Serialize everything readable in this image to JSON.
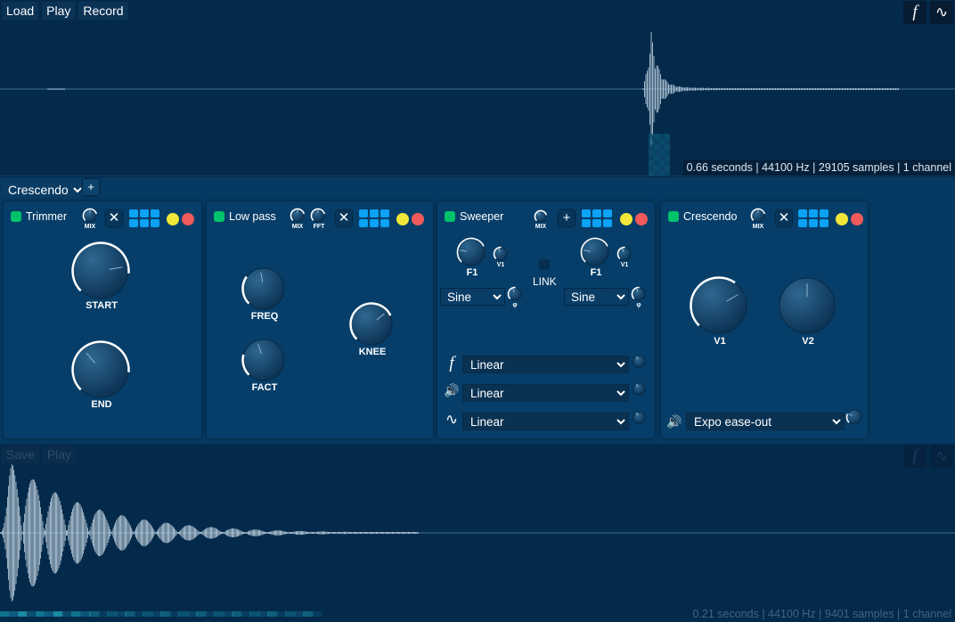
{
  "top_panel": {
    "buttons": [
      "Load",
      "Play",
      "Record"
    ],
    "view_icons": [
      "f",
      "∿"
    ],
    "info": "0.66 seconds | 44100 Hz | 29105 samples | 1 channel"
  },
  "chain": {
    "selected": "Crescendo",
    "add_label": "+"
  },
  "trimmer": {
    "title": "Trimmer",
    "mix_label": "MIX",
    "close_label": "✕",
    "knobs": {
      "start": "START",
      "end": "END"
    }
  },
  "lowpass": {
    "title": "Low pass",
    "mix_label": "MIX",
    "fft_label": "FFT",
    "close_label": "✕",
    "knobs": {
      "freq": "FREQ",
      "fact": "FACT",
      "knee": "KNEE"
    }
  },
  "sweeper": {
    "title": "Sweeper",
    "mix_label": "MIX",
    "add_label": "+",
    "f1_label": "F1",
    "v1_label": "V1",
    "phi_label": "φ",
    "link_label": "LINK",
    "wave_left": "Sine",
    "wave_right": "Sine",
    "curves": [
      {
        "icon": "f",
        "value": "Linear"
      },
      {
        "icon": "🔊",
        "value": "Linear"
      },
      {
        "icon": "∿",
        "value": "Linear"
      }
    ]
  },
  "crescendo": {
    "title": "Crescendo",
    "mix_label": "MIX",
    "close_label": "✕",
    "knobs": {
      "v1": "V1",
      "v2": "V2"
    },
    "curve_icon": "🔊",
    "curve_value": "Expo ease-out"
  },
  "bottom_panel": {
    "buttons": [
      "Save",
      "Play"
    ],
    "view_icons": [
      "f",
      "∿"
    ],
    "info": "0.21 seconds | 44100 Hz | 9401 samples | 1 channel"
  },
  "colors": {
    "led": "#00c26b",
    "blocks": "#0ca2f5",
    "yellow_dot": "#f2e739",
    "red_dot": "#f05a5a"
  }
}
